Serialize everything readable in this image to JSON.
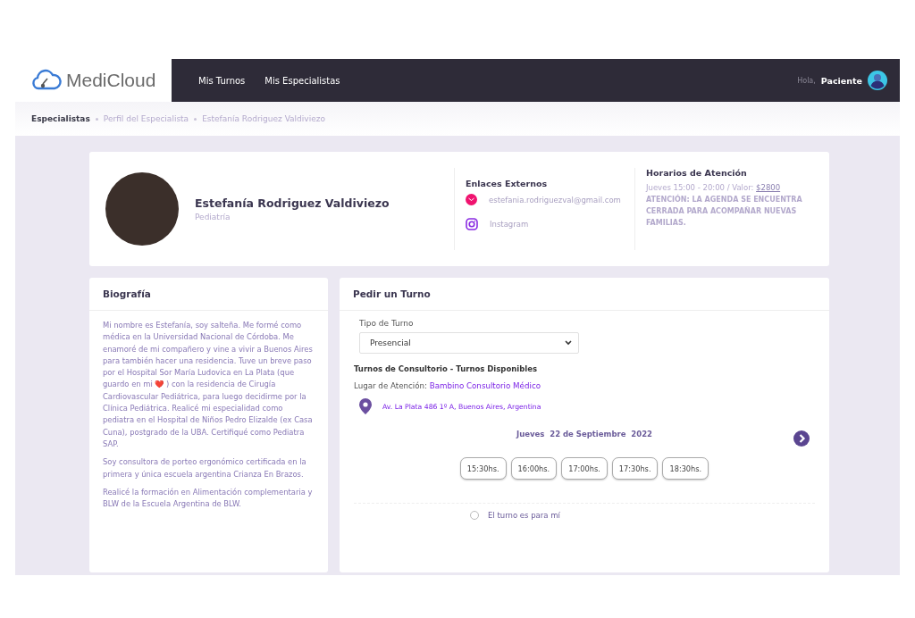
{
  "brand": {
    "name": "MediCloud"
  },
  "nav": {
    "items": [
      {
        "label": "Mis Turnos"
      },
      {
        "label": "Mis Especialistas"
      }
    ],
    "greeting": "Hola,",
    "user": "Paciente"
  },
  "breadcrumb": [
    {
      "label": "Especialistas",
      "active": true
    },
    {
      "label": "Perfil del Especialista",
      "active": false
    },
    {
      "label": "Estefanía Rodriguez Valdiviezo",
      "active": false
    }
  ],
  "profile": {
    "name": "Estefanía Rodriguez Valdiviezo",
    "specialty": "Pediatría",
    "links_title": "Enlaces Externos",
    "links": [
      {
        "kind": "email",
        "label": "estefania.rodriguezval@gmail.com"
      },
      {
        "kind": "instagram",
        "label": "Instagram"
      }
    ],
    "hours_title": "Horarios de Atención",
    "hours": "Jueves 15:00 - 20:00 / Valor: ",
    "price": "$2800",
    "notice": "ATENCIÓN: LA AGENDA SE ENCUENTRA CERRADA PARA ACOMPAÑAR NUEVAS FAMILIAS."
  },
  "bio": {
    "title": "Biografía",
    "paragraphs": [
      "Mi nombre es Estefanía, soy salteña. Me formé como médica en la Universidad Nacional de Córdoba. Me enamoré de mi compañero y vine a vivir a Buenos Aires para también hacer una residencia. Tuve un breve paso por el Hospital Sor María Ludovica en La Plata (que guardo en mi ❤️ ) con la residencia de Cirugía Cardiovascular Pediátrica, para luego decidirme por la Clínica Pediátrica. Realicé mi especialidad como pediatra en el Hospital de Niños Pedro Elizalde (ex Casa Cuna), postgrado de la UBA. Certifiqué como Pediatra SAP.",
      "Soy consultora de porteo ergonómico certificada en la primera y única escuela argentina Crianza En Brazos.",
      "Realicé la formación en Alimentación complementaria y BLW de la Escuela Argentina de BLW."
    ]
  },
  "booking": {
    "title": "Pedir un Turno",
    "type_label": "Tipo de Turno",
    "type_value": "Presencial",
    "section_title": "Turnos de Consultorio - Turnos Disponibles",
    "place_label": "Lugar de Atención: ",
    "place": "Bambino Consultorio Médico",
    "address": "Av. La Plata 486 1º A, Buenos Aires, Argentina",
    "date": "Jueves  22 de Septiembre  2022",
    "slots": [
      "15:30hs.",
      "16:00hs.",
      "17:00hs.",
      "17:30hs.",
      "18:30hs."
    ],
    "for_me": {
      "label": "El turno es para mí",
      "selected": false
    }
  }
}
